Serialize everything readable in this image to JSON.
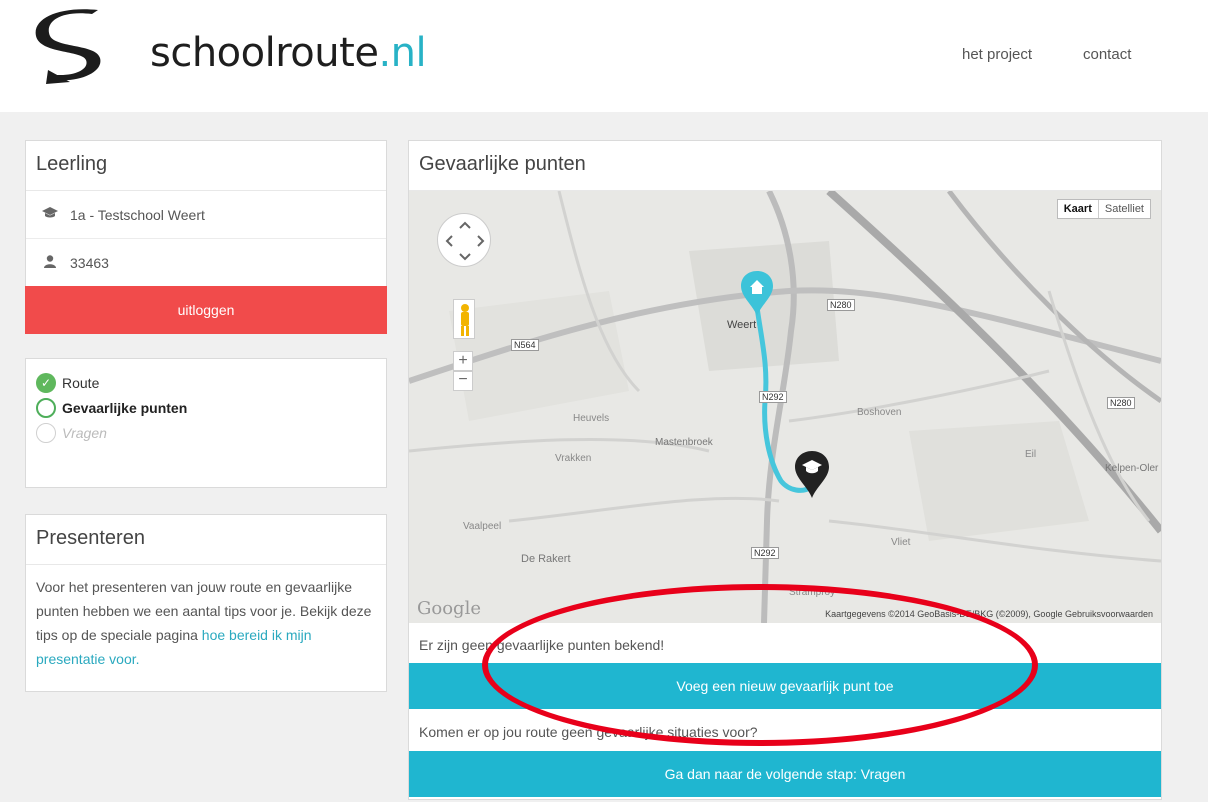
{
  "brand": {
    "name": "schoolroute",
    "tld": ".nl"
  },
  "nav": {
    "project": "het project",
    "contact": "contact"
  },
  "leerling": {
    "title": "Leerling",
    "school": "1a - Testschool Weert",
    "student_id": "33463",
    "logout": "uitloggen"
  },
  "steps": [
    {
      "label": "Route",
      "state": "done"
    },
    {
      "label": "Gevaarlijke punten",
      "state": "active"
    },
    {
      "label": "Vragen",
      "state": "pending"
    }
  ],
  "present": {
    "title": "Presenteren",
    "text": "Voor het presenteren van jouw route en gevaarlijke punten hebben we een aantal tips voor je. Bekijk deze tips op de speciale pagina ",
    "link": "hoe bereid ik mijn presentatie voor."
  },
  "main": {
    "title": "Gevaarlijke punten",
    "map": {
      "toggle_map": "Kaart",
      "toggle_sat": "Satelliet",
      "place_weert": "Weert",
      "place_a": "Mastenbroek",
      "place_b": "Heuvels",
      "place_c": "Vrakken",
      "place_d": "De Rakert",
      "place_e": "Vaalpeel",
      "place_f": "Vliet",
      "place_g": "Kelpen-Oler",
      "place_h": "Boshoven",
      "place_i": "Eil",
      "place_j": "Stramproy",
      "road_1": "N280",
      "road_2": "N564",
      "road_3": "N292",
      "road_4": "N280",
      "road_5": "N292",
      "credit": "Kaartgegevens ©2014 GeoBasis-DE/BKG (©2009), Google   Gebruiksvoorwaarden",
      "google": "Google"
    },
    "info_none": "Er zijn geen gevaarlijke punten bekend!",
    "add_button": "Voeg een nieuw gevaarlijk punt toe",
    "info_question": "Komen er op jou route geen gevaarlijke situaties voor?",
    "next_button": "Ga dan naar de volgende stap: Vragen"
  },
  "colors": {
    "accent": "#1fb6d0",
    "danger": "#f14b4b",
    "success": "#5fb85d",
    "annotation": "#e8001a"
  }
}
